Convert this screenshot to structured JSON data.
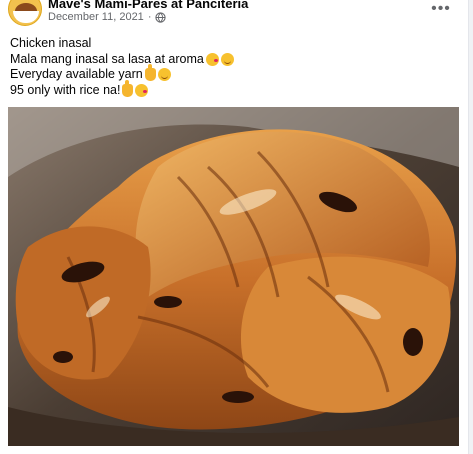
{
  "post": {
    "page_name": "Mave's Mami-Pares at Panciteria",
    "date": "December 11, 2021",
    "more_label": "•••",
    "caption_lines": [
      {
        "text": "Chicken inasal",
        "emojis": []
      },
      {
        "text": "Mala mang inasal sa lasa at aroma",
        "emojis": [
          "face-blowing-kiss-emoji",
          "smiling-face-emoji"
        ]
      },
      {
        "text": "Everyday available yarn",
        "emojis": [
          "thumbs-up-emoji",
          "smiling-face-emoji"
        ]
      },
      {
        "text": "95 only with rice na!",
        "emojis": [
          "thumbs-up-emoji",
          "face-blowing-kiss-emoji"
        ]
      }
    ]
  },
  "colors": {
    "page_bg": "#f0f2f5",
    "card_bg": "#ffffff",
    "meta_text": "#65676b"
  }
}
